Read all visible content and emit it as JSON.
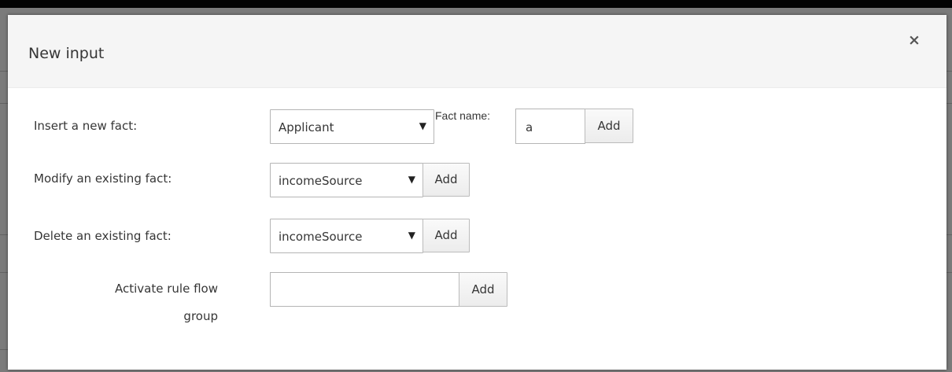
{
  "dialog": {
    "title": "New input",
    "close_label": "×"
  },
  "insert_fact": {
    "label": "Insert a new fact:",
    "selected": "Applicant",
    "fact_name_label": "Fact name:",
    "fact_name_value": "a",
    "add_label": "Add"
  },
  "modify_fact": {
    "label": "Modify an existing fact:",
    "selected": "incomeSource",
    "add_label": "Add"
  },
  "delete_fact": {
    "label": "Delete an existing fact:",
    "selected": "incomeSource",
    "add_label": "Add"
  },
  "rule_flow": {
    "label_line1": "Activate rule flow",
    "label_line2": "group",
    "value": "",
    "add_label": "Add"
  },
  "icons": {
    "dropdown": "caret-down-icon",
    "close": "close-icon"
  }
}
